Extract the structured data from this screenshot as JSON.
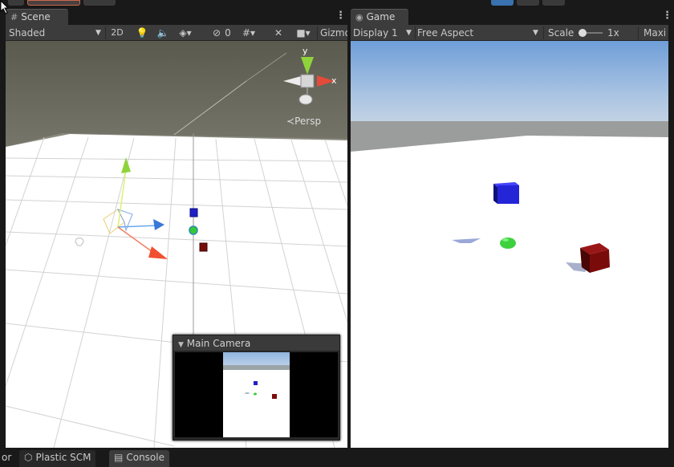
{
  "scene_tab": {
    "label": "Scene",
    "icon": "hash-icon"
  },
  "game_tab": {
    "label": "Game",
    "icon": "gamepad-icon"
  },
  "scene_toolbar": {
    "shading": "Shaded",
    "mode_2d": "2D",
    "hidden_count": "0",
    "gizmos": "Gizmo"
  },
  "game_toolbar": {
    "display": "Display 1",
    "aspect": "Free Aspect",
    "scale_label": "Scale",
    "scale_value": "1x",
    "maximize": "Maxi"
  },
  "orientation_gizmo": {
    "y": "y",
    "x": "x",
    "projection": "Persp"
  },
  "camera_preview": {
    "title": "Main Camera"
  },
  "bottom_tabs": [
    {
      "label": "or"
    },
    {
      "label": "Plastic SCM"
    },
    {
      "label": "Console"
    }
  ],
  "colors": {
    "panel": "#3c3c3c",
    "background": "#191919",
    "blue_cube": "#2020c8",
    "red_cube": "#8a0c0c",
    "green_sphere": "#35c935",
    "accent_blue": "#3a72b0"
  }
}
